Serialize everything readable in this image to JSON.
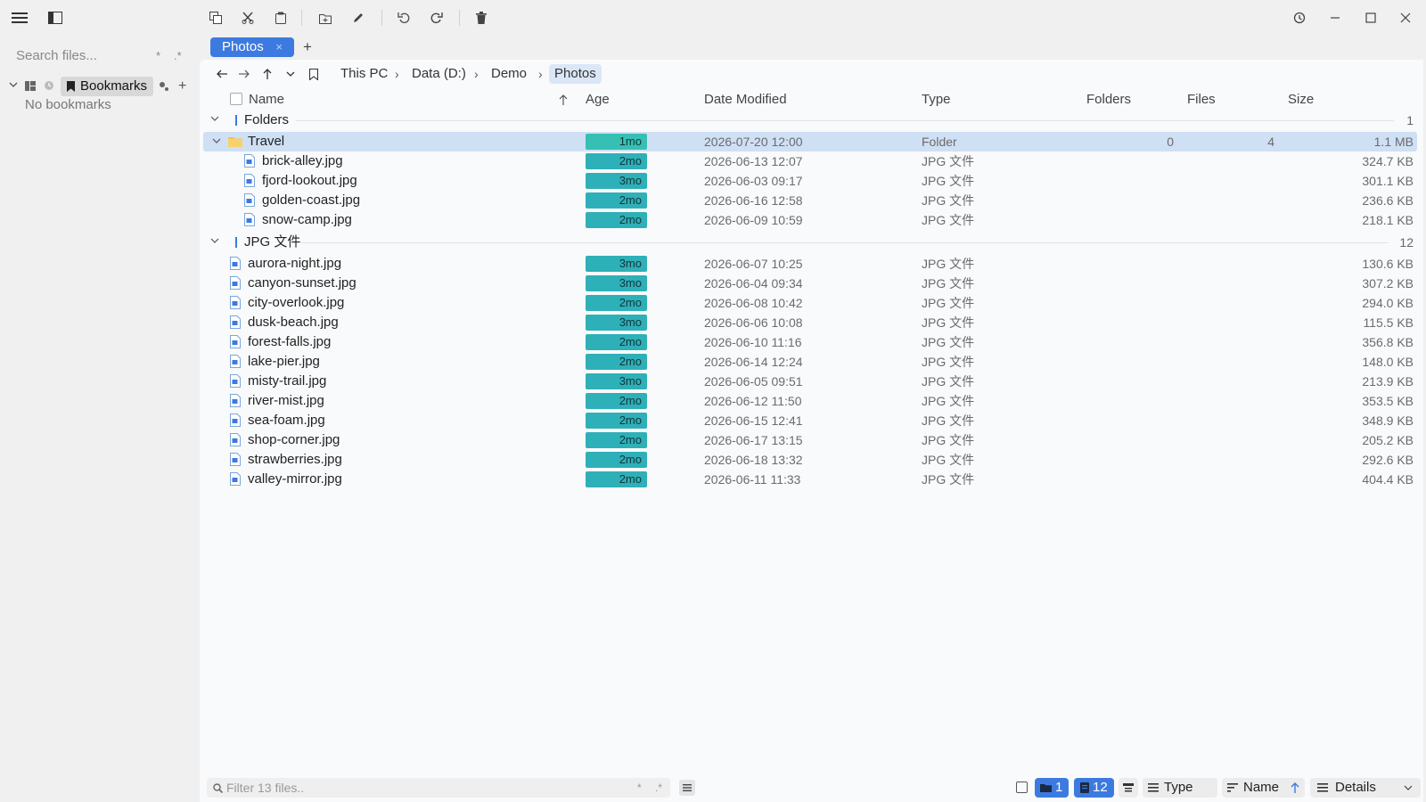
{
  "sidebar": {
    "search_placeholder": "Search files...",
    "search_token_wild": "*",
    "search_token_regex": ".*",
    "bookmarks_label": "Bookmarks",
    "no_bookmarks": "No bookmarks",
    "add_label": "+"
  },
  "tabs": [
    {
      "label": "Photos",
      "close": "×"
    }
  ],
  "new_tab_label": "+",
  "breadcrumb": [
    "This PC",
    "Data (D:)",
    "Demo",
    "Photos"
  ],
  "breadcrumb_sep": "›",
  "columns": {
    "name": "Name",
    "age": "Age",
    "date": "Date Modified",
    "type": "Type",
    "folders": "Folders",
    "files": "Files",
    "size": "Size"
  },
  "groups": [
    {
      "title": "Folders",
      "count": "1"
    },
    {
      "title": "JPG 文件",
      "count": "12"
    }
  ],
  "folder_row": {
    "name": "Travel",
    "age": "1mo",
    "date": "2026-07-20 12:00",
    "type": "Folder",
    "folders": "0",
    "files": "4",
    "size": "1.1 MB"
  },
  "folder_children": [
    {
      "name": "brick-alley.jpg",
      "age": "2mo",
      "date": "2026-06-13 12:07",
      "type": "JPG 文件",
      "size": "324.7 KB"
    },
    {
      "name": "fjord-lookout.jpg",
      "age": "3mo",
      "date": "2026-06-03 09:17",
      "type": "JPG 文件",
      "size": "301.1 KB"
    },
    {
      "name": "golden-coast.jpg",
      "age": "2mo",
      "date": "2026-06-16 12:58",
      "type": "JPG 文件",
      "size": "236.6 KB"
    },
    {
      "name": "snow-camp.jpg",
      "age": "2mo",
      "date": "2026-06-09 10:59",
      "type": "JPG 文件",
      "size": "218.1 KB"
    }
  ],
  "files": [
    {
      "name": "aurora-night.jpg",
      "age": "3mo",
      "date": "2026-06-07 10:25",
      "type": "JPG 文件",
      "size": "130.6 KB"
    },
    {
      "name": "canyon-sunset.jpg",
      "age": "3mo",
      "date": "2026-06-04 09:34",
      "type": "JPG 文件",
      "size": "307.2 KB"
    },
    {
      "name": "city-overlook.jpg",
      "age": "2mo",
      "date": "2026-06-08 10:42",
      "type": "JPG 文件",
      "size": "294.0 KB"
    },
    {
      "name": "dusk-beach.jpg",
      "age": "3mo",
      "date": "2026-06-06 10:08",
      "type": "JPG 文件",
      "size": "115.5 KB"
    },
    {
      "name": "forest-falls.jpg",
      "age": "2mo",
      "date": "2026-06-10 11:16",
      "type": "JPG 文件",
      "size": "356.8 KB"
    },
    {
      "name": "lake-pier.jpg",
      "age": "2mo",
      "date": "2026-06-14 12:24",
      "type": "JPG 文件",
      "size": "148.0 KB"
    },
    {
      "name": "misty-trail.jpg",
      "age": "3mo",
      "date": "2026-06-05 09:51",
      "type": "JPG 文件",
      "size": "213.9 KB"
    },
    {
      "name": "river-mist.jpg",
      "age": "2mo",
      "date": "2026-06-12 11:50",
      "type": "JPG 文件",
      "size": "353.5 KB"
    },
    {
      "name": "sea-foam.jpg",
      "age": "2mo",
      "date": "2026-06-15 12:41",
      "type": "JPG 文件",
      "size": "348.9 KB"
    },
    {
      "name": "shop-corner.jpg",
      "age": "2mo",
      "date": "2026-06-17 13:15",
      "type": "JPG 文件",
      "size": "205.2 KB"
    },
    {
      "name": "strawberries.jpg",
      "age": "2mo",
      "date": "2026-06-18 13:32",
      "type": "JPG 文件",
      "size": "292.6 KB"
    },
    {
      "name": "valley-mirror.jpg",
      "age": "2mo",
      "date": "2026-06-11 11:33",
      "type": "JPG 文件",
      "size": "404.4 KB"
    }
  ],
  "statusbar": {
    "filter_placeholder": "Filter 13 files..",
    "filter_token_wild": "*",
    "filter_token_regex": ".*",
    "folder_count": "1",
    "file_count": "12",
    "group_by": "Type",
    "sort_by": "Name",
    "view_mode": "Details"
  },
  "colors": {
    "accent": "#3d7ae0",
    "age_badge": "#2eb0b8",
    "selection": "#cfe0f5"
  }
}
